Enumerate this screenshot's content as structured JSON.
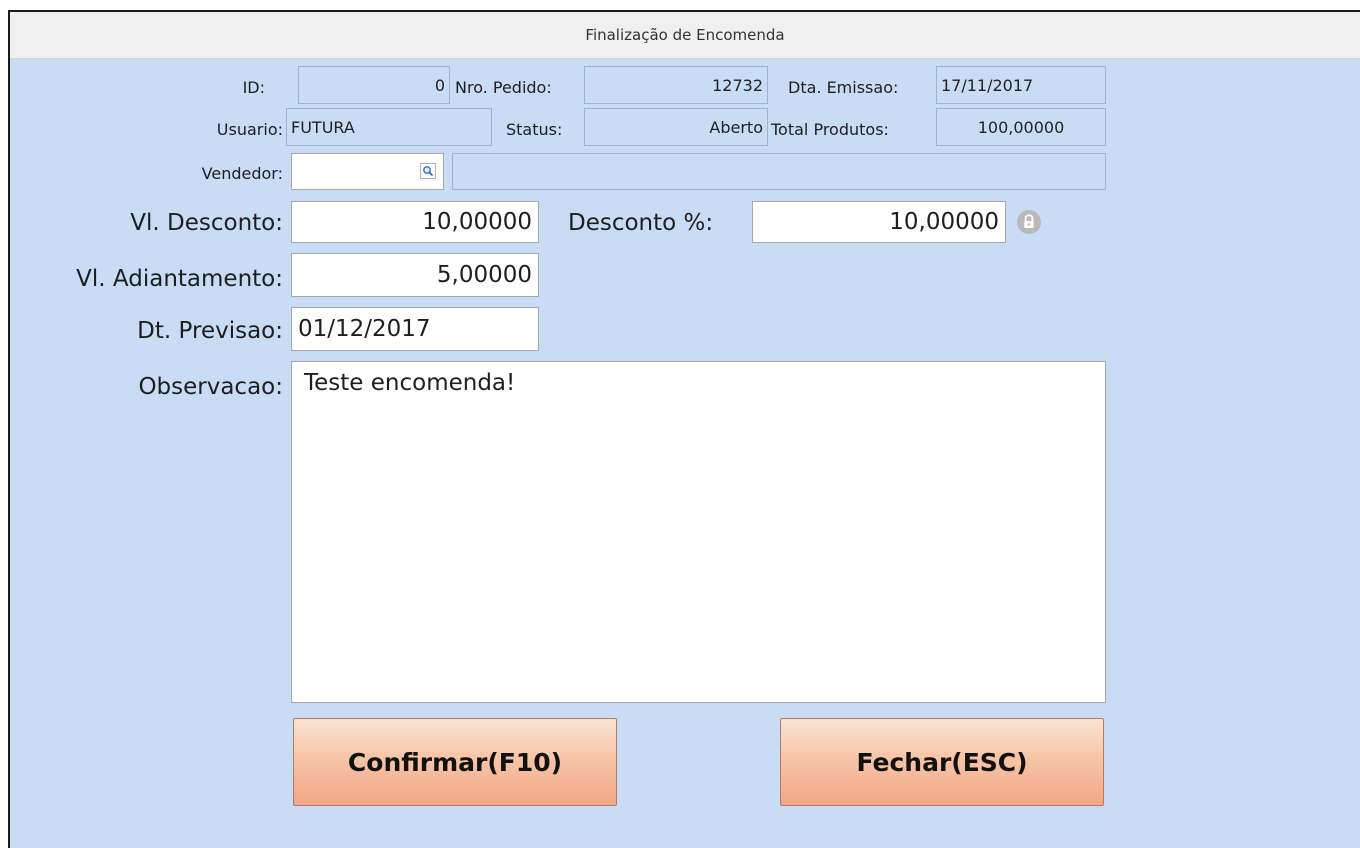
{
  "window": {
    "title": "Finalização de Encomenda"
  },
  "header_fields": {
    "id": {
      "label": "ID:",
      "value": "0"
    },
    "nro_pedido": {
      "label": "Nro. Pedido:",
      "value": "12732"
    },
    "dta_emissao": {
      "label": "Dta. Emissao:",
      "value": "17/11/2017"
    },
    "usuario": {
      "label": "Usuario:",
      "value": "FUTURA"
    },
    "status": {
      "label": "Status:",
      "value": "Aberto"
    },
    "total_produtos": {
      "label": "Total Produtos:",
      "value": "100,00000"
    },
    "vendedor": {
      "label": "Vendedor:",
      "code": "",
      "name": ""
    }
  },
  "form": {
    "vl_desconto": {
      "label": "Vl. Desconto:",
      "value": "10,00000"
    },
    "desconto_pct": {
      "label": "Desconto %:",
      "value": "10,00000"
    },
    "vl_adiantamento": {
      "label": "Vl. Adiantamento:",
      "value": "5,00000"
    },
    "dt_previsao": {
      "label": "Dt. Previsao:",
      "value": "01/12/2017"
    },
    "observacao": {
      "label": "Observacao:",
      "value": "Teste encomenda!"
    }
  },
  "buttons": {
    "confirmar": "Confirmar(F10)",
    "fechar": "Fechar(ESC)"
  },
  "icons": {
    "lookup": "search-icon",
    "lock": "lock-icon"
  },
  "colors": {
    "background": "#c9dcf6",
    "button_top": "#fce3d4",
    "button_bottom": "#f2a786"
  }
}
